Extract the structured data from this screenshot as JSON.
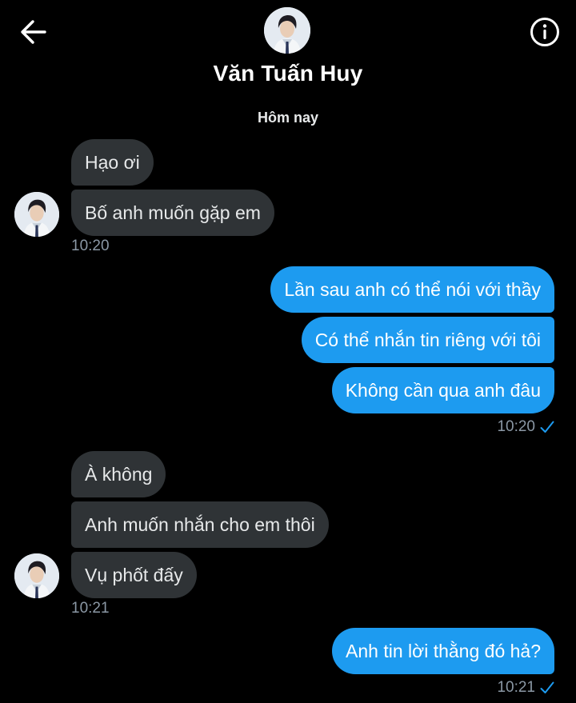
{
  "header": {
    "contact_name": "Văn Tuấn Huy",
    "back_icon": "arrow-left-icon",
    "info_icon": "info-icon"
  },
  "date_separator": "Hôm nay",
  "messages": [
    {
      "text": "Hạo ơi",
      "direction": "incoming"
    },
    {
      "text": "Bố anh muốn gặp em",
      "direction": "incoming"
    },
    {
      "text": "Lần sau anh có thể nói với thầy",
      "direction": "outgoing"
    },
    {
      "text": "Có thể nhắn tin riêng với tôi",
      "direction": "outgoing"
    },
    {
      "text": "Không cần qua anh đâu",
      "direction": "outgoing"
    },
    {
      "text": "À không",
      "direction": "incoming"
    },
    {
      "text": "Anh muốn nhắn cho em thôi",
      "direction": "incoming"
    },
    {
      "text": "Vụ phốt đấy",
      "direction": "incoming"
    },
    {
      "text": "Anh tin lời thằng đó hả?",
      "direction": "outgoing"
    }
  ],
  "timestamps": [
    "10:20",
    "10:20",
    "10:21",
    "10:21"
  ],
  "colors": {
    "background": "#000000",
    "incoming_bubble": "#2f3336",
    "outgoing_bubble": "#1d9bf0",
    "timestamp": "#8b98a5",
    "read_check": "#1d9bf0"
  }
}
